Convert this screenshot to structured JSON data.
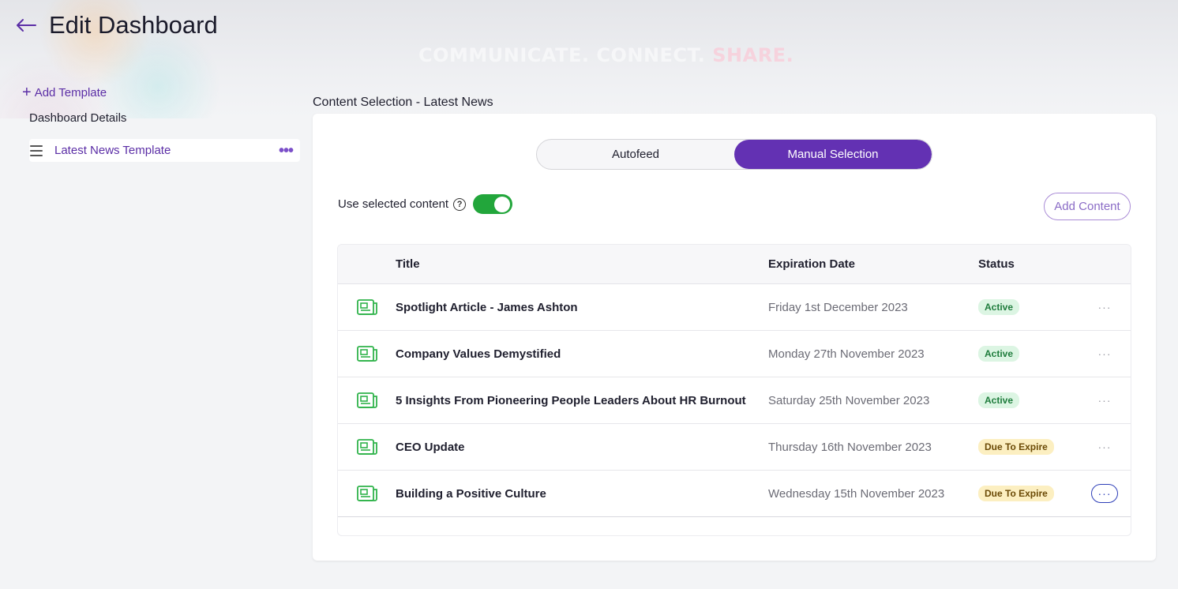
{
  "header": {
    "title": "Edit Dashboard",
    "back_icon": "arrow-left-icon"
  },
  "hero": {
    "tagline_main": "COMMUNICATE. CONNECT. ",
    "tagline_accent": "SHARE."
  },
  "sidebar": {
    "add_template_label": "Add Template",
    "dashboard_details_label": "Dashboard Details",
    "items": [
      {
        "label": "Latest News Template",
        "more_label": "•••"
      }
    ]
  },
  "content": {
    "section_title": "Content Selection - Latest News",
    "tabs": [
      {
        "label": "Autofeed",
        "active": false
      },
      {
        "label": "Manual Selection",
        "active": true
      }
    ],
    "toggle": {
      "label": "Use selected content",
      "help_glyph": "?",
      "enabled": true
    },
    "add_content_label": "Add Content",
    "table": {
      "headers": {
        "title": "Title",
        "expiration": "Expiration Date",
        "status": "Status"
      },
      "rows": [
        {
          "title": "Spotlight Article - James Ashton",
          "expiration": "Friday 1st December 2023",
          "status": "Active",
          "status_kind": "active",
          "menu": "···"
        },
        {
          "title": "Company Values Demystified",
          "expiration": "Monday 27th November 2023",
          "status": "Active",
          "status_kind": "active",
          "menu": "···"
        },
        {
          "title": "5 Insights From Pioneering People Leaders About HR Burnout",
          "expiration": "Saturday 25th November 2023",
          "status": "Active",
          "status_kind": "active",
          "menu": "···"
        },
        {
          "title": "CEO Update",
          "expiration": "Thursday 16th November 2023",
          "status": "Due To Expire",
          "status_kind": "due",
          "menu": "···"
        },
        {
          "title": "Building a Positive Culture",
          "expiration": "Wednesday 15th November 2023",
          "status": "Due To Expire",
          "status_kind": "due",
          "menu": "···"
        }
      ]
    }
  },
  "colors": {
    "brand_purple": "#6331b3",
    "toggle_green": "#22a63b",
    "icon_green": "#2fb34a"
  }
}
